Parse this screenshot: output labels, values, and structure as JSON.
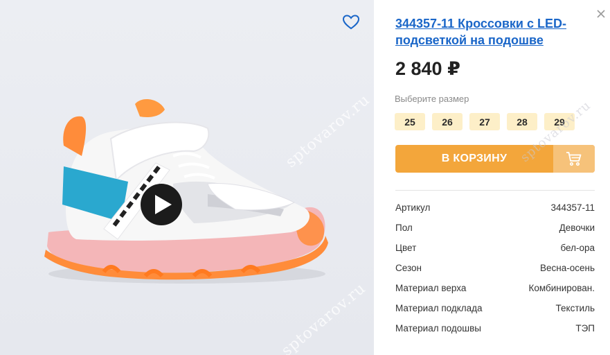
{
  "product": {
    "title": "344357-11 Кроссовки с LED-подсветкой на подошве",
    "price": "2 840 ₽",
    "image_alt": "Кроссовки",
    "watermark": "sptovarov.ru"
  },
  "sizes": {
    "label": "Выберите размер",
    "options": [
      "25",
      "26",
      "27",
      "28",
      "29"
    ]
  },
  "cart": {
    "label": "В КОРЗИНУ",
    "icon": "cart-icon"
  },
  "specs": [
    {
      "key": "Артикул",
      "value": "344357-11"
    },
    {
      "key": "Пол",
      "value": "Девочки"
    },
    {
      "key": "Цвет",
      "value": "бел-ора"
    },
    {
      "key": "Сезон",
      "value": "Весна-осень"
    },
    {
      "key": "Материал верха",
      "value": "Комбинирован."
    },
    {
      "key": "Материал подклада",
      "value": "Текстиль"
    },
    {
      "key": "Материал подошвы",
      "value": "ТЭП"
    }
  ],
  "colors": {
    "accent": "#f3a63b",
    "link": "#1a66c8",
    "size_chip": "#fdefc8"
  }
}
